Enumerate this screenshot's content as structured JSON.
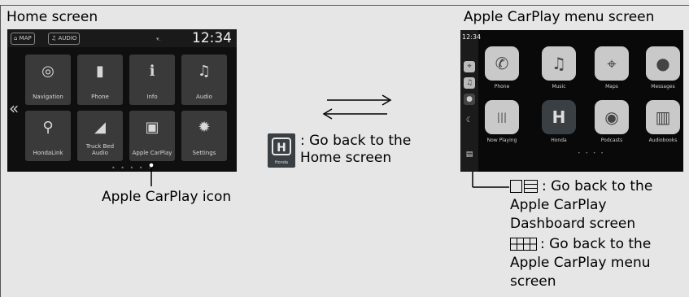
{
  "headings": {
    "home": "Home screen",
    "carplay": "Apple CarPlay menu screen"
  },
  "home_screen": {
    "tabs": [
      "MAP",
      "AUDIO"
    ],
    "clock": "12:34",
    "tiles": [
      {
        "label": "Navigation",
        "icon": "navigation-icon",
        "glyph": "◎"
      },
      {
        "label": "Phone",
        "icon": "phone-icon",
        "glyph": "▮"
      },
      {
        "label": "Info",
        "icon": "info-icon",
        "glyph": "ℹ"
      },
      {
        "label": "Audio",
        "icon": "audio-icon",
        "glyph": "♫"
      },
      {
        "label": "HondaLink",
        "icon": "hondalink-icon",
        "glyph": "⚲"
      },
      {
        "label": "Truck Bed Audio",
        "icon": "truck-bed-audio-icon",
        "glyph": "◢"
      },
      {
        "label": "Apple CarPlay",
        "icon": "apple-carplay-icon",
        "glyph": "▣"
      },
      {
        "label": "Settings",
        "icon": "settings-icon",
        "glyph": "✹"
      }
    ]
  },
  "carplay_screen": {
    "clock": "12:34",
    "apps": [
      {
        "label": "Phone",
        "icon": "phone-icon",
        "glyph": "✆"
      },
      {
        "label": "Music",
        "icon": "music-icon",
        "glyph": "♫"
      },
      {
        "label": "Maps",
        "icon": "maps-icon",
        "glyph": "⌖"
      },
      {
        "label": "Messages",
        "icon": "messages-icon",
        "glyph": "●"
      },
      {
        "label": "Now Playing",
        "icon": "now-playing-icon",
        "glyph": "|||"
      },
      {
        "label": "Honda",
        "icon": "honda-icon",
        "glyph": "H"
      },
      {
        "label": "Podcasts",
        "icon": "podcasts-icon",
        "glyph": "◉"
      },
      {
        "label": "Audiobooks",
        "icon": "audiobooks-icon",
        "glyph": "▥"
      }
    ]
  },
  "captions": {
    "carplay_icon": "Apple CarPlay icon",
    "honda_line1": ": Go back to the",
    "honda_line2": "Home screen",
    "dash_line1": ": Go back to the",
    "dash_line2": "Apple CarPlay",
    "dash_line3": "Dashboard screen",
    "menu_line1": ": Go back to the",
    "menu_line2": "Apple CarPlay menu",
    "menu_line3": "screen"
  },
  "colors": {
    "background": "#e6e6e6",
    "screen": "#0f0f0f",
    "tile": "#3a3a3a"
  }
}
